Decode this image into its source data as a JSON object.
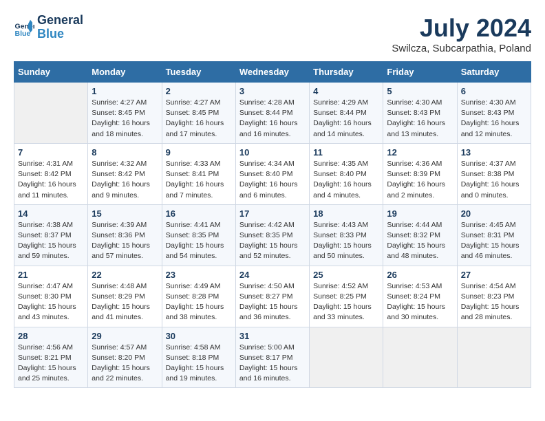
{
  "header": {
    "logo_line1": "General",
    "logo_line2": "Blue",
    "month_title": "July 2024",
    "subtitle": "Swilcza, Subcarpathia, Poland"
  },
  "days_of_week": [
    "Sunday",
    "Monday",
    "Tuesday",
    "Wednesday",
    "Thursday",
    "Friday",
    "Saturday"
  ],
  "weeks": [
    [
      {
        "day": "",
        "info": ""
      },
      {
        "day": "1",
        "info": "Sunrise: 4:27 AM\nSunset: 8:45 PM\nDaylight: 16 hours\nand 18 minutes."
      },
      {
        "day": "2",
        "info": "Sunrise: 4:27 AM\nSunset: 8:45 PM\nDaylight: 16 hours\nand 17 minutes."
      },
      {
        "day": "3",
        "info": "Sunrise: 4:28 AM\nSunset: 8:44 PM\nDaylight: 16 hours\nand 16 minutes."
      },
      {
        "day": "4",
        "info": "Sunrise: 4:29 AM\nSunset: 8:44 PM\nDaylight: 16 hours\nand 14 minutes."
      },
      {
        "day": "5",
        "info": "Sunrise: 4:30 AM\nSunset: 8:43 PM\nDaylight: 16 hours\nand 13 minutes."
      },
      {
        "day": "6",
        "info": "Sunrise: 4:30 AM\nSunset: 8:43 PM\nDaylight: 16 hours\nand 12 minutes."
      }
    ],
    [
      {
        "day": "7",
        "info": "Sunrise: 4:31 AM\nSunset: 8:42 PM\nDaylight: 16 hours\nand 11 minutes."
      },
      {
        "day": "8",
        "info": "Sunrise: 4:32 AM\nSunset: 8:42 PM\nDaylight: 16 hours\nand 9 minutes."
      },
      {
        "day": "9",
        "info": "Sunrise: 4:33 AM\nSunset: 8:41 PM\nDaylight: 16 hours\nand 7 minutes."
      },
      {
        "day": "10",
        "info": "Sunrise: 4:34 AM\nSunset: 8:40 PM\nDaylight: 16 hours\nand 6 minutes."
      },
      {
        "day": "11",
        "info": "Sunrise: 4:35 AM\nSunset: 8:40 PM\nDaylight: 16 hours\nand 4 minutes."
      },
      {
        "day": "12",
        "info": "Sunrise: 4:36 AM\nSunset: 8:39 PM\nDaylight: 16 hours\nand 2 minutes."
      },
      {
        "day": "13",
        "info": "Sunrise: 4:37 AM\nSunset: 8:38 PM\nDaylight: 16 hours\nand 0 minutes."
      }
    ],
    [
      {
        "day": "14",
        "info": "Sunrise: 4:38 AM\nSunset: 8:37 PM\nDaylight: 15 hours\nand 59 minutes."
      },
      {
        "day": "15",
        "info": "Sunrise: 4:39 AM\nSunset: 8:36 PM\nDaylight: 15 hours\nand 57 minutes."
      },
      {
        "day": "16",
        "info": "Sunrise: 4:41 AM\nSunset: 8:35 PM\nDaylight: 15 hours\nand 54 minutes."
      },
      {
        "day": "17",
        "info": "Sunrise: 4:42 AM\nSunset: 8:35 PM\nDaylight: 15 hours\nand 52 minutes."
      },
      {
        "day": "18",
        "info": "Sunrise: 4:43 AM\nSunset: 8:33 PM\nDaylight: 15 hours\nand 50 minutes."
      },
      {
        "day": "19",
        "info": "Sunrise: 4:44 AM\nSunset: 8:32 PM\nDaylight: 15 hours\nand 48 minutes."
      },
      {
        "day": "20",
        "info": "Sunrise: 4:45 AM\nSunset: 8:31 PM\nDaylight: 15 hours\nand 46 minutes."
      }
    ],
    [
      {
        "day": "21",
        "info": "Sunrise: 4:47 AM\nSunset: 8:30 PM\nDaylight: 15 hours\nand 43 minutes."
      },
      {
        "day": "22",
        "info": "Sunrise: 4:48 AM\nSunset: 8:29 PM\nDaylight: 15 hours\nand 41 minutes."
      },
      {
        "day": "23",
        "info": "Sunrise: 4:49 AM\nSunset: 8:28 PM\nDaylight: 15 hours\nand 38 minutes."
      },
      {
        "day": "24",
        "info": "Sunrise: 4:50 AM\nSunset: 8:27 PM\nDaylight: 15 hours\nand 36 minutes."
      },
      {
        "day": "25",
        "info": "Sunrise: 4:52 AM\nSunset: 8:25 PM\nDaylight: 15 hours\nand 33 minutes."
      },
      {
        "day": "26",
        "info": "Sunrise: 4:53 AM\nSunset: 8:24 PM\nDaylight: 15 hours\nand 30 minutes."
      },
      {
        "day": "27",
        "info": "Sunrise: 4:54 AM\nSunset: 8:23 PM\nDaylight: 15 hours\nand 28 minutes."
      }
    ],
    [
      {
        "day": "28",
        "info": "Sunrise: 4:56 AM\nSunset: 8:21 PM\nDaylight: 15 hours\nand 25 minutes."
      },
      {
        "day": "29",
        "info": "Sunrise: 4:57 AM\nSunset: 8:20 PM\nDaylight: 15 hours\nand 22 minutes."
      },
      {
        "day": "30",
        "info": "Sunrise: 4:58 AM\nSunset: 8:18 PM\nDaylight: 15 hours\nand 19 minutes."
      },
      {
        "day": "31",
        "info": "Sunrise: 5:00 AM\nSunset: 8:17 PM\nDaylight: 15 hours\nand 16 minutes."
      },
      {
        "day": "",
        "info": ""
      },
      {
        "day": "",
        "info": ""
      },
      {
        "day": "",
        "info": ""
      }
    ]
  ]
}
